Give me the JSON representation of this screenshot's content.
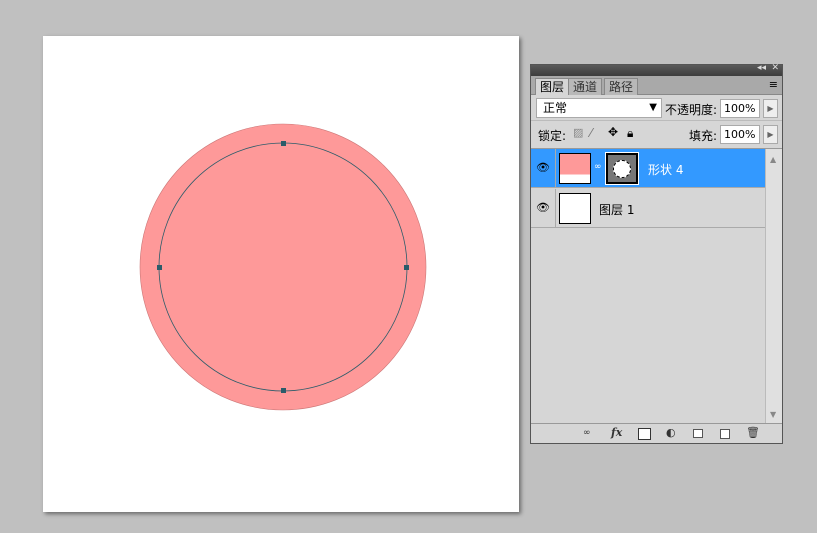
{
  "canvas": {
    "shape_fill": "#fe9999",
    "path_color": "#2b5c6a"
  },
  "panel": {
    "title_controls": [
      "◂◂",
      "✕"
    ],
    "tabs": [
      {
        "label": "图层",
        "active": true
      },
      {
        "label": "通道",
        "active": false
      },
      {
        "label": "路径",
        "active": false
      }
    ],
    "menu_icon": "≡",
    "blend_mode": "正常",
    "opacity_label": "不透明度:",
    "opacity_value": "100%",
    "lock_label": "锁定:",
    "fill_label": "填充:",
    "fill_value": "100%",
    "layers": [
      {
        "name": "形状 4",
        "selected": true,
        "thumb_color": "#fe9999"
      },
      {
        "name": "图层 1",
        "selected": false,
        "thumb_color": "#ffffff"
      }
    ],
    "bottom_icons": [
      "link-icon",
      "fx-icon",
      "mask-icon",
      "adjustment-icon",
      "group-icon",
      "new-layer-icon",
      "trash-icon"
    ],
    "fx_label": "fx"
  }
}
